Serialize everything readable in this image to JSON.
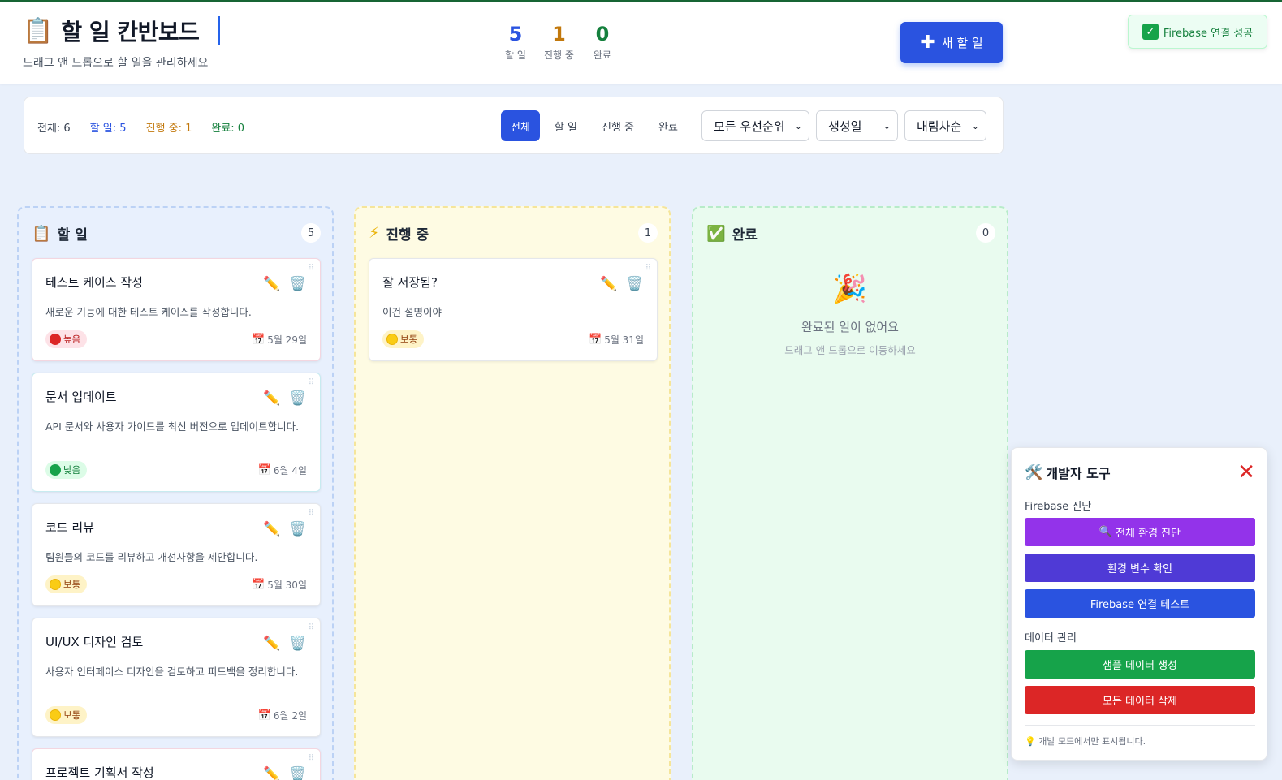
{
  "header": {
    "icon": "📋",
    "title": "할 일 칸반보드",
    "subtitle": "드래그 앤 드롭으로 할 일을 관리하세요",
    "stats": [
      {
        "value": "5",
        "label": "할 일",
        "color": "#2a53e0"
      },
      {
        "value": "1",
        "label": "진행 중",
        "color": "#c2780c"
      },
      {
        "value": "0",
        "label": "완료",
        "color": "#15803d"
      }
    ],
    "new_button": {
      "icon": "plus-icon",
      "label": "새 할 일"
    }
  },
  "toast": {
    "label": "Firebase 연결 성공",
    "icon": "check-icon"
  },
  "filterbar": {
    "counts": {
      "all": "전체: 6",
      "todo": "할 일: 5",
      "progress": "진행 중: 1",
      "done": "완료: 0"
    },
    "tabs": [
      "전체",
      "할 일",
      "진행 중",
      "완료"
    ],
    "active_tab": "전체",
    "selects": {
      "priority": "모든 우선순위",
      "sort_field": "생성일",
      "sort_order": "내림차순"
    }
  },
  "columns": {
    "todo": {
      "icon": "📋",
      "title": "할 일",
      "count": "5",
      "cards": [
        {
          "title": "테스트 케이스 작성",
          "desc": "새로운 기능에 대한 테스트 케이스를 작성합니다.",
          "priority": "높음",
          "date": "5월 29일"
        },
        {
          "title": "문서 업데이트",
          "desc": "API 문서와 사용자 가이드를 최신 버전으로 업데이트합니다.",
          "priority": "낮음",
          "date": "6월 4일"
        },
        {
          "title": "코드 리뷰",
          "desc": "팀원들의 코드를 리뷰하고 개선사항을 제안합니다.",
          "priority": "보통",
          "date": "5월 30일"
        },
        {
          "title": "UI/UX 디자인 검토",
          "desc": "사용자 인터페이스 디자인을 검토하고 피드백을 정리합니다.",
          "priority": "보통",
          "date": "6월 2일"
        },
        {
          "title": "프로젝트 기획서 작성"
        }
      ]
    },
    "progress": {
      "icon": "⚡",
      "title": "진행 중",
      "count": "1",
      "cards": [
        {
          "title": "잘 저장됨?",
          "desc": "이건 설명이야",
          "priority": "보통",
          "date": "5월 31일"
        }
      ]
    },
    "done": {
      "icon": "✅",
      "title": "완료",
      "count": "0",
      "empty": {
        "icon": "🎉",
        "title": "완료된 일이 없어요",
        "subtitle": "드래그 앤 드롭으로 이동하세요"
      }
    }
  },
  "devtools": {
    "icon": "🛠️",
    "title": "개발자 도구",
    "close_icon": "❌",
    "sections": {
      "firebase": "Firebase 진단",
      "data": "데이터 관리"
    },
    "buttons": {
      "diagnose": "전체 환경 진단",
      "env": "환경 변수 확인",
      "conn": "Firebase 연결 테스트",
      "sample": "샘플 데이터 생성",
      "delete": "모든 데이터 삭제"
    },
    "button_colors": {
      "diagnose": "#9333ea",
      "env": "#4f3ad6",
      "conn": "#2a53e0",
      "sample": "#16a34a",
      "delete": "#dc2626"
    },
    "note": "개발 모드에서만 표시됩니다."
  },
  "colors": {
    "accent": "#2a53e0",
    "todo": "#2a53e0",
    "progress": "#c2780c",
    "done": "#15803d"
  }
}
